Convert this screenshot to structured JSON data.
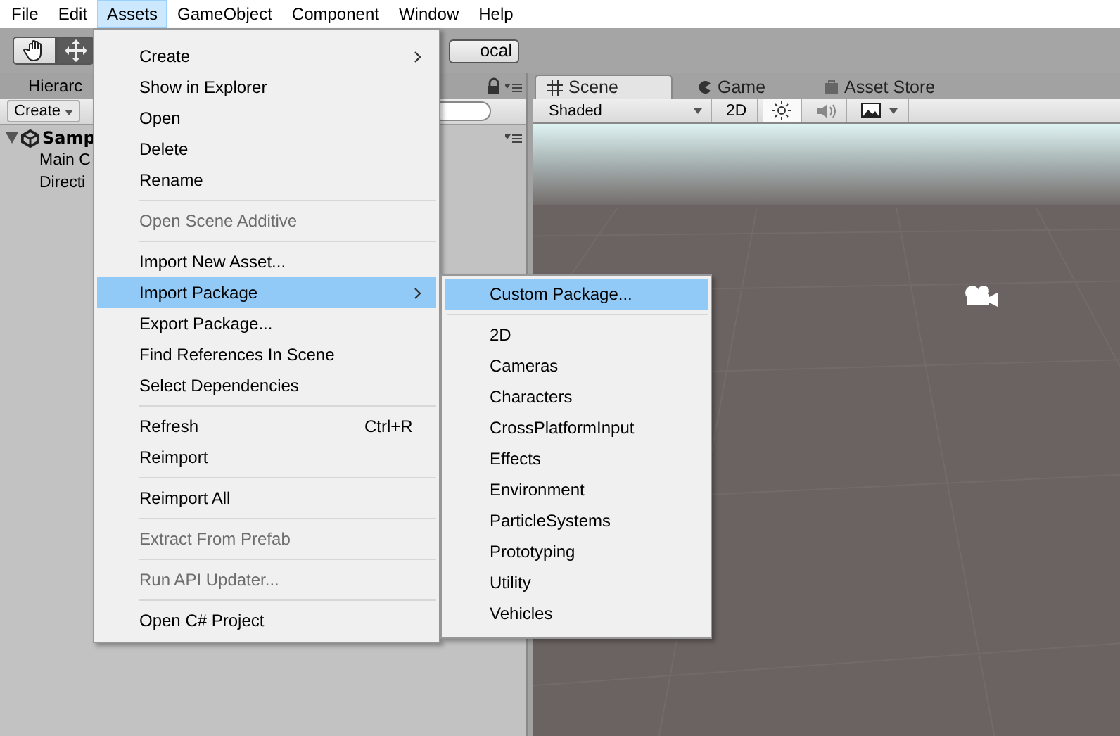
{
  "menubar": [
    {
      "label": "File",
      "selected": false
    },
    {
      "label": "Edit",
      "selected": false
    },
    {
      "label": "Assets",
      "selected": true
    },
    {
      "label": "GameObject",
      "selected": false
    },
    {
      "label": "Component",
      "selected": false
    },
    {
      "label": "Window",
      "selected": false
    },
    {
      "label": "Help",
      "selected": false
    }
  ],
  "toolbar": {
    "pivot_button": "ocal"
  },
  "hierarchy": {
    "tab": "Hierarc",
    "create": "Create",
    "scene": "Samp",
    "rows": [
      "Main C",
      "Directi"
    ]
  },
  "scene_tabs": [
    {
      "label": "Scene",
      "selected": true
    },
    {
      "label": "Game",
      "selected": false
    },
    {
      "label": "Asset Store",
      "selected": false
    }
  ],
  "scene_toolbar": {
    "shading": "Shaded",
    "mode_2d": "2D",
    "lighting_on": true,
    "audio_on": false
  },
  "assets_menu": [
    {
      "kind": "item",
      "label": "Create",
      "submenu": true,
      "disabled": false,
      "selected": false
    },
    {
      "kind": "item",
      "label": "Show in Explorer",
      "submenu": false,
      "disabled": false,
      "selected": false
    },
    {
      "kind": "item",
      "label": "Open",
      "submenu": false,
      "disabled": false,
      "selected": false
    },
    {
      "kind": "item",
      "label": "Delete",
      "submenu": false,
      "disabled": false,
      "selected": false
    },
    {
      "kind": "item",
      "label": "Rename",
      "submenu": false,
      "disabled": false,
      "selected": false
    },
    {
      "kind": "separator"
    },
    {
      "kind": "item",
      "label": "Open Scene Additive",
      "submenu": false,
      "disabled": true,
      "selected": false
    },
    {
      "kind": "separator"
    },
    {
      "kind": "item",
      "label": "Import New Asset...",
      "submenu": false,
      "disabled": false,
      "selected": false
    },
    {
      "kind": "item",
      "label": "Import Package",
      "submenu": true,
      "disabled": false,
      "selected": true
    },
    {
      "kind": "item",
      "label": "Export Package...",
      "submenu": false,
      "disabled": false,
      "selected": false
    },
    {
      "kind": "item",
      "label": "Find References In Scene",
      "submenu": false,
      "disabled": false,
      "selected": false
    },
    {
      "kind": "item",
      "label": "Select Dependencies",
      "submenu": false,
      "disabled": false,
      "selected": false
    },
    {
      "kind": "separator"
    },
    {
      "kind": "item",
      "label": "Refresh",
      "shortcut": "Ctrl+R",
      "submenu": false,
      "disabled": false,
      "selected": false
    },
    {
      "kind": "item",
      "label": "Reimport",
      "submenu": false,
      "disabled": false,
      "selected": false
    },
    {
      "kind": "separator"
    },
    {
      "kind": "item",
      "label": "Reimport All",
      "submenu": false,
      "disabled": false,
      "selected": false
    },
    {
      "kind": "separator"
    },
    {
      "kind": "item",
      "label": "Extract From Prefab",
      "submenu": false,
      "disabled": true,
      "selected": false
    },
    {
      "kind": "separator"
    },
    {
      "kind": "item",
      "label": "Run API Updater...",
      "submenu": false,
      "disabled": true,
      "selected": false
    },
    {
      "kind": "separator"
    },
    {
      "kind": "item",
      "label": "Open C# Project",
      "submenu": false,
      "disabled": false,
      "selected": false
    }
  ],
  "import_package_menu": [
    {
      "kind": "item",
      "label": "Custom Package...",
      "selected": true
    },
    {
      "kind": "separator"
    },
    {
      "kind": "item",
      "label": "2D",
      "selected": false
    },
    {
      "kind": "item",
      "label": "Cameras",
      "selected": false
    },
    {
      "kind": "item",
      "label": "Characters",
      "selected": false
    },
    {
      "kind": "item",
      "label": "CrossPlatformInput",
      "selected": false
    },
    {
      "kind": "item",
      "label": "Effects",
      "selected": false
    },
    {
      "kind": "item",
      "label": "Environment",
      "selected": false
    },
    {
      "kind": "item",
      "label": "ParticleSystems",
      "selected": false
    },
    {
      "kind": "item",
      "label": "Prototyping",
      "selected": false
    },
    {
      "kind": "item",
      "label": "Utility",
      "selected": false
    },
    {
      "kind": "item",
      "label": "Vehicles",
      "selected": false
    }
  ]
}
